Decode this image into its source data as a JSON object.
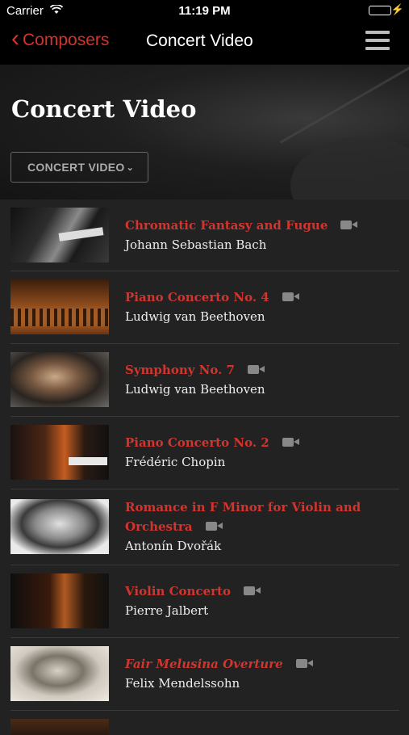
{
  "status_bar": {
    "carrier": "Carrier",
    "time": "11:19 PM"
  },
  "nav": {
    "back_label": "Composers",
    "title": "Concert Video"
  },
  "hero": {
    "heading": "Concert Video",
    "dropdown_label": "CONCERT VIDEO"
  },
  "items": [
    {
      "title": "Chromatic Fantasy and Fugue",
      "composer": "Johann Sebastian Bach",
      "thumb_icon": "pianist-photo"
    },
    {
      "title": "Piano Concerto No. 4",
      "composer": "Ludwig van Beethoven",
      "thumb_icon": "orchestra-photo"
    },
    {
      "title": "Symphony No. 7",
      "composer": "Ludwig van Beethoven",
      "thumb_icon": "beethoven-portrait"
    },
    {
      "title": "Piano Concerto No. 2",
      "composer": "Frédéric Chopin",
      "thumb_icon": "pianist-photo"
    },
    {
      "title": "Romance in F Minor for Violin and Orchestra",
      "composer": "Antonín Dvořák",
      "thumb_icon": "dvorak-portrait"
    },
    {
      "title": "Violin Concerto",
      "composer": "Pierre Jalbert",
      "thumb_icon": "violinist-photo"
    },
    {
      "title": "Fair Melusina Overture",
      "composer": "Felix Mendelssohn",
      "thumb_icon": "mendelssohn-portrait"
    }
  ],
  "colors": {
    "accent": "#d2342e",
    "background": "#222222",
    "bar": "#000000"
  }
}
